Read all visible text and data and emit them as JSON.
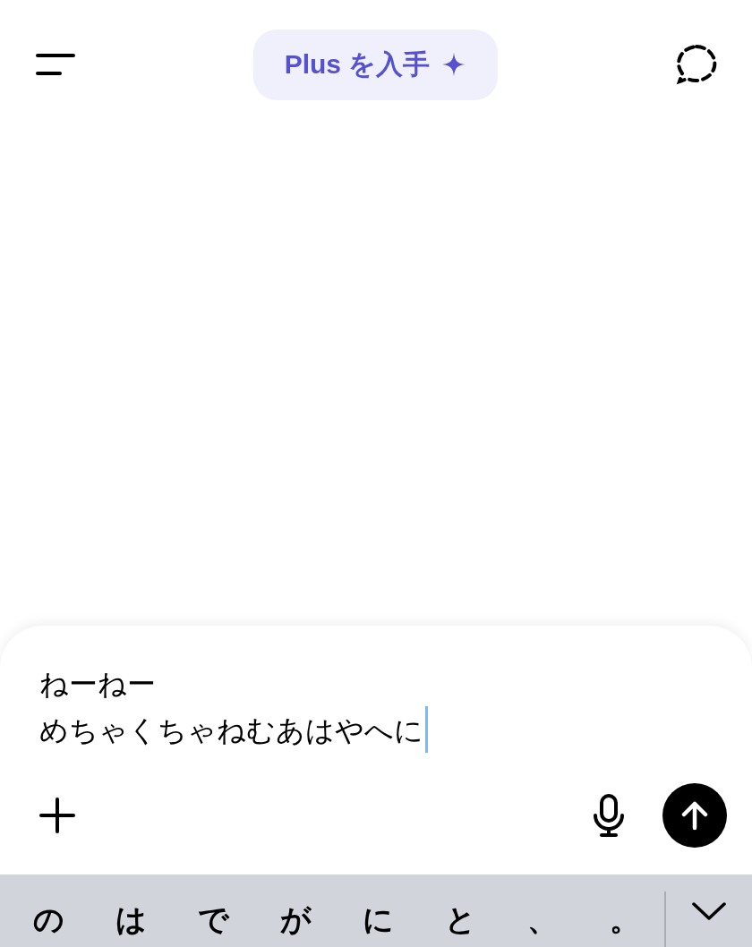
{
  "header": {
    "upgrade_button": {
      "label": "Plus を入手"
    }
  },
  "composer": {
    "value_lines": [
      "ねーねー",
      "めちゃくちゃねむあはやへに"
    ]
  },
  "keyboard": {
    "candidates": [
      "の",
      "は",
      "で",
      "が",
      "に",
      "と",
      "、",
      "。"
    ]
  }
}
